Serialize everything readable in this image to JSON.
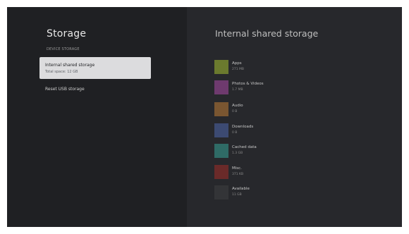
{
  "left_panel": {
    "title": "Storage",
    "section_label": "DEVICE STORAGE",
    "items": [
      {
        "label": "Internal shared storage",
        "sub": "Total space: 12 GB"
      },
      {
        "label": "Reset USB storage"
      }
    ]
  },
  "right_panel": {
    "title": "Internal shared storage",
    "categories": [
      {
        "name": "Apps",
        "size": "271 MB",
        "color": "#6b7a2e"
      },
      {
        "name": "Photos & Videos",
        "size": "1.7 MB",
        "color": "#6e3a6e"
      },
      {
        "name": "Audio",
        "size": "0 B",
        "color": "#7a5631"
      },
      {
        "name": "Downloads",
        "size": "0 B",
        "color": "#3c4a72"
      },
      {
        "name": "Cached data",
        "size": "1.3 GB",
        "color": "#2f6b66"
      },
      {
        "name": "Misc.",
        "size": "371 KB",
        "color": "#6a2a29"
      },
      {
        "name": "Available",
        "size": "11 GB",
        "color": "#333437"
      }
    ]
  }
}
